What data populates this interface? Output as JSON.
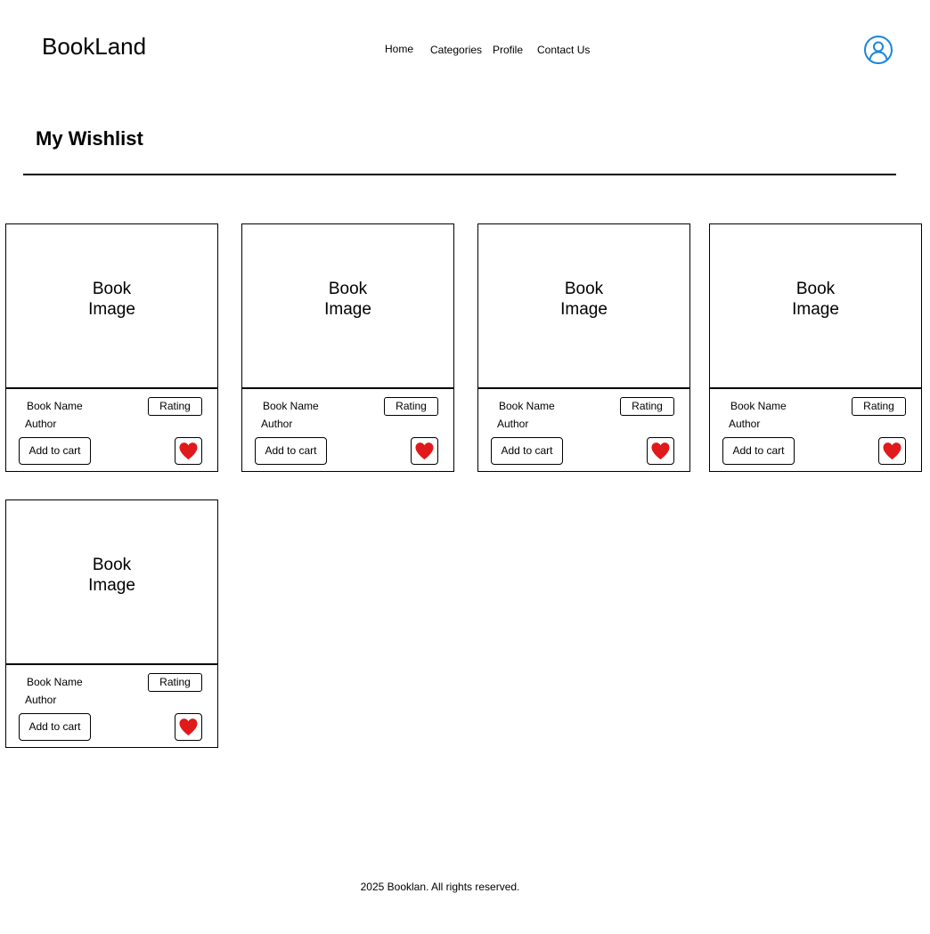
{
  "header": {
    "logo": "BookLand",
    "nav": {
      "home": "Home",
      "categories": "Categories",
      "profile": "Profile",
      "contact": "Contact Us"
    },
    "profile_icon": "user-circle-icon"
  },
  "page": {
    "title": "My Wishlist"
  },
  "colors": {
    "accent": "#1a86d8",
    "heart": "#e0191b"
  },
  "wishlist": [
    {
      "image_label": "Book\nImage",
      "name": "Book Name",
      "author": "Author",
      "rating": "Rating",
      "cart_label": "Add to cart",
      "wish_icon": "heart-icon"
    },
    {
      "image_label": "Book\nImage",
      "name": "Book Name",
      "author": "Author",
      "rating": "Rating",
      "cart_label": "Add to cart",
      "wish_icon": "heart-icon"
    },
    {
      "image_label": "Book\nImage",
      "name": "Book Name",
      "author": "Author",
      "rating": "Rating",
      "cart_label": "Add to cart",
      "wish_icon": "heart-icon"
    },
    {
      "image_label": "Book\nImage",
      "name": "Book Name",
      "author": "Author",
      "rating": "Rating",
      "cart_label": "Add to cart",
      "wish_icon": "heart-icon"
    },
    {
      "image_label": "Book\nImage",
      "name": "Book Name",
      "author": "Author",
      "rating": "Rating",
      "cart_label": "Add to cart",
      "wish_icon": "heart-icon"
    }
  ],
  "footer": {
    "text": "2025 Booklan. All rights reserved."
  }
}
